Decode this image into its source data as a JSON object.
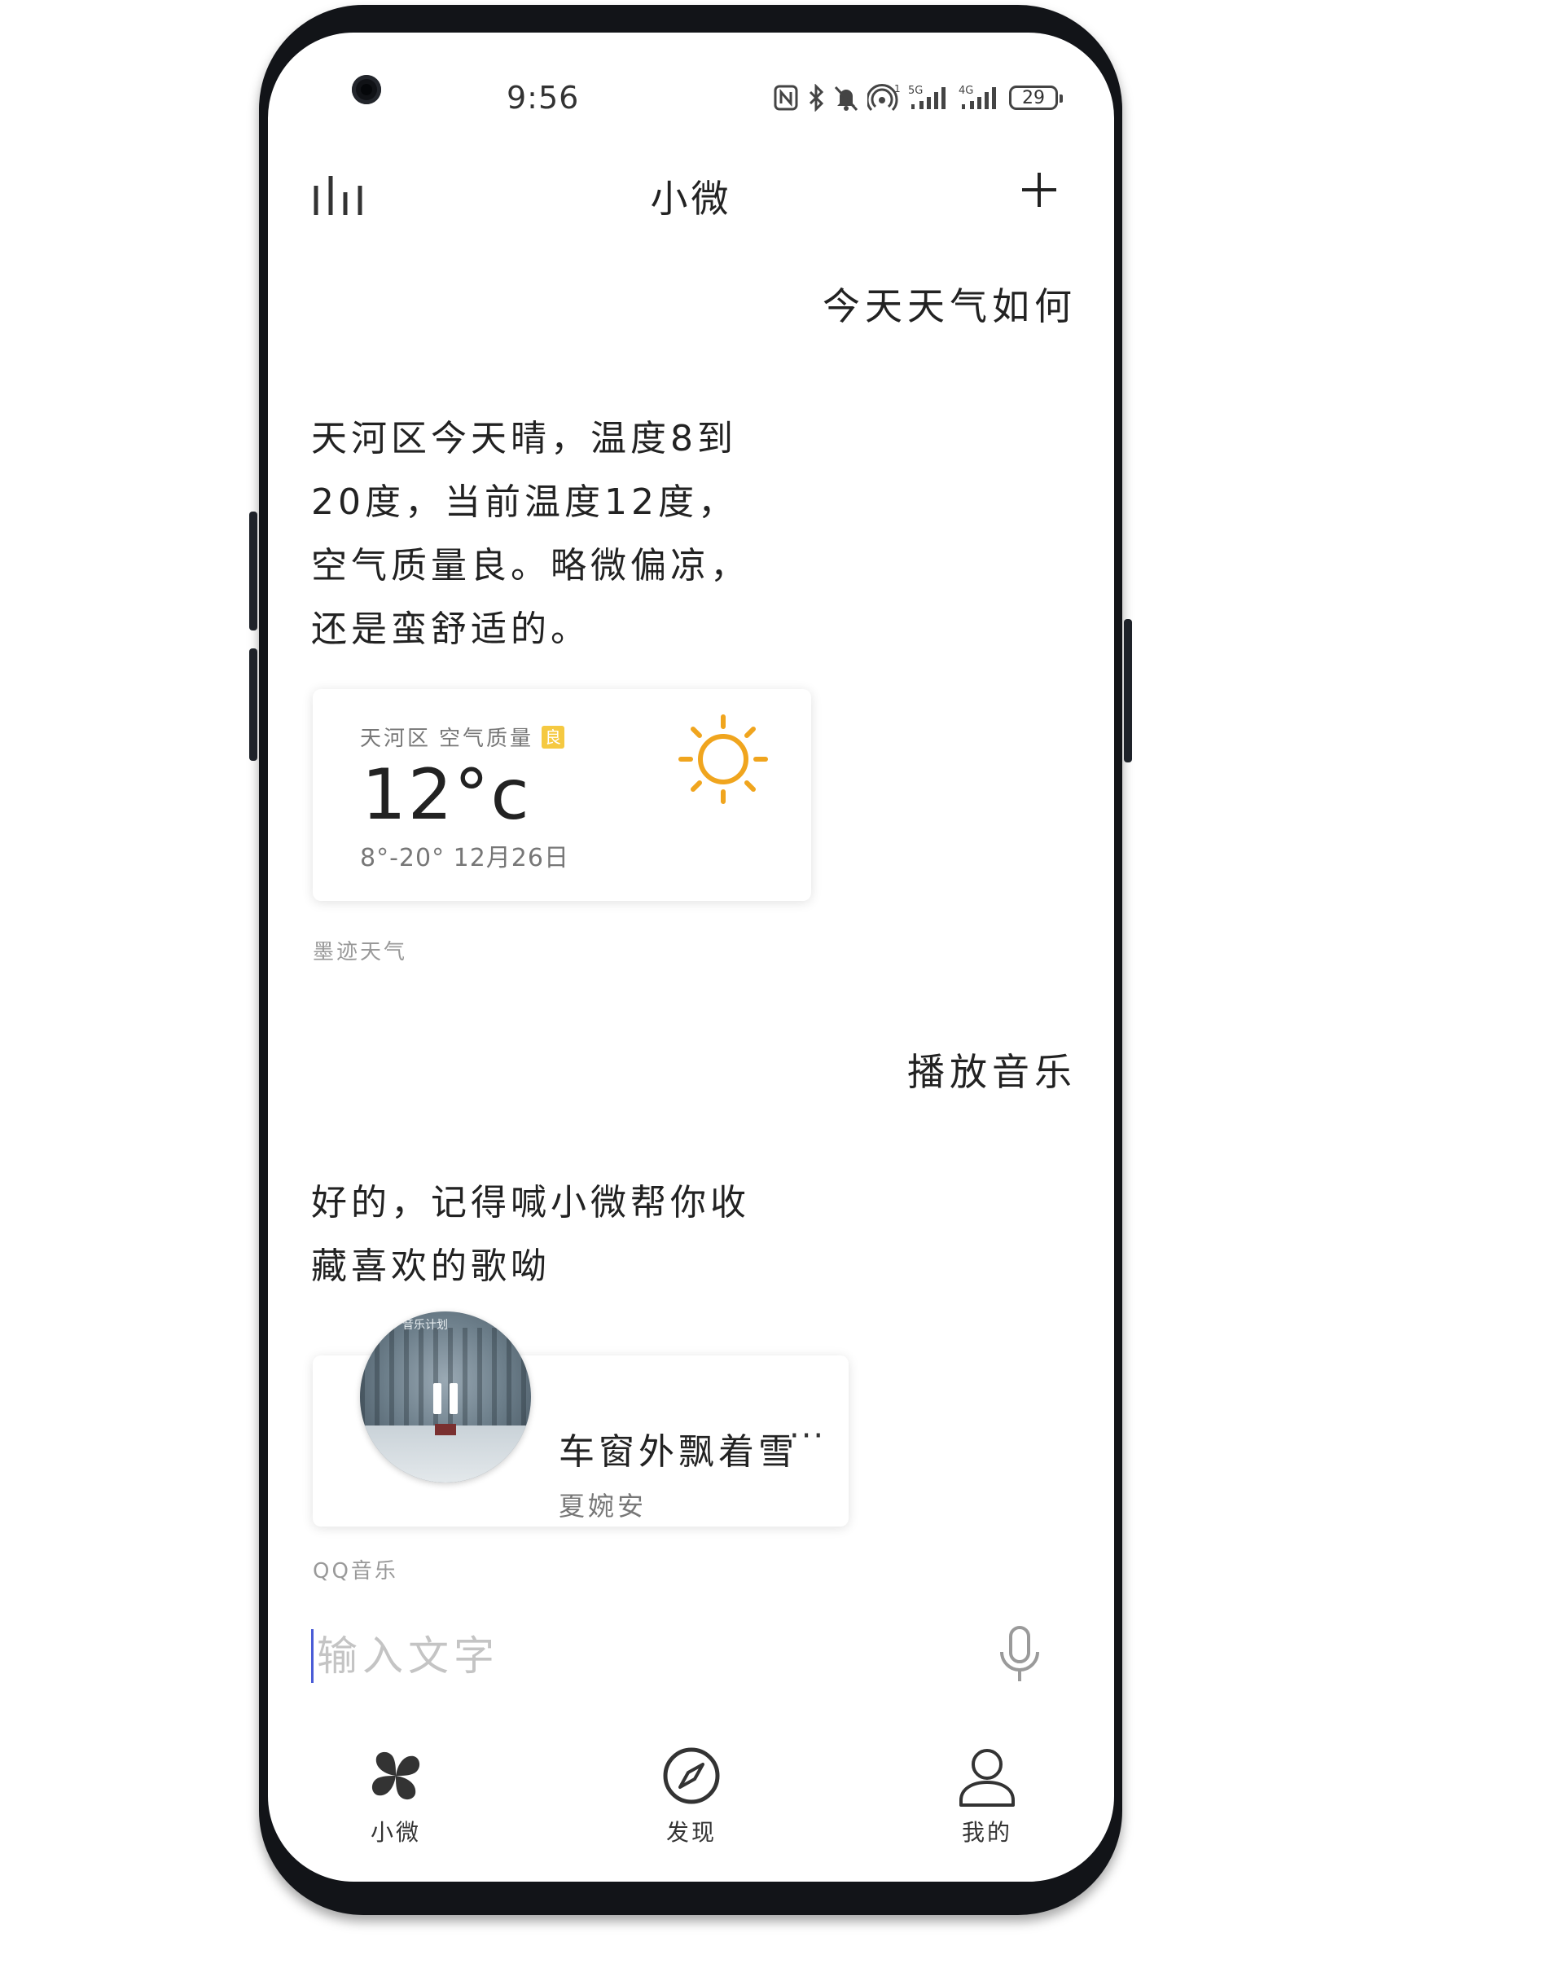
{
  "status_bar": {
    "time": "9:56",
    "battery": "29",
    "icons": [
      "nfc-icon",
      "bluetooth-icon",
      "mute-icon",
      "hotspot-icon",
      "signal-5g-icon",
      "signal-4g-icon",
      "battery-icon"
    ],
    "network_5g": "5G",
    "network_4g": "4G"
  },
  "header": {
    "title": "小微",
    "left_icon": "equalizer-icon",
    "right_icon": "plus-icon"
  },
  "conversation": {
    "user_query_1": "今天天气如何",
    "bot_reply_1": "天河区今天晴，温度8到20度，当前温度12度，空气质量良。略微偏凉，还是蛮舒适的。",
    "weather_card": {
      "location": "天河区",
      "air_quality_label": "空气质量",
      "air_quality_value": "良",
      "temperature": "12°c",
      "range_date": "8°-20°  12月26日",
      "icon": "sun-icon",
      "icon_color": "#f0a51e",
      "source": "墨迹天气"
    },
    "user_query_2": "播放音乐",
    "bot_reply_2": "好的，记得喊小微帮你收藏喜欢的歌呦",
    "music_card": {
      "album_tag": "音乐计划",
      "song_title": "车窗外飘着雪",
      "artist": "夏婉安",
      "more_label": "···",
      "source": "QQ音乐"
    }
  },
  "input": {
    "placeholder": "输入文字",
    "value": "",
    "accent_color": "#4a5cd6"
  },
  "bottom_nav": {
    "tabs": [
      {
        "label": "小微",
        "icon": "pinwheel-icon"
      },
      {
        "label": "发现",
        "icon": "compass-icon"
      },
      {
        "label": "我的",
        "icon": "user-icon"
      }
    ]
  }
}
